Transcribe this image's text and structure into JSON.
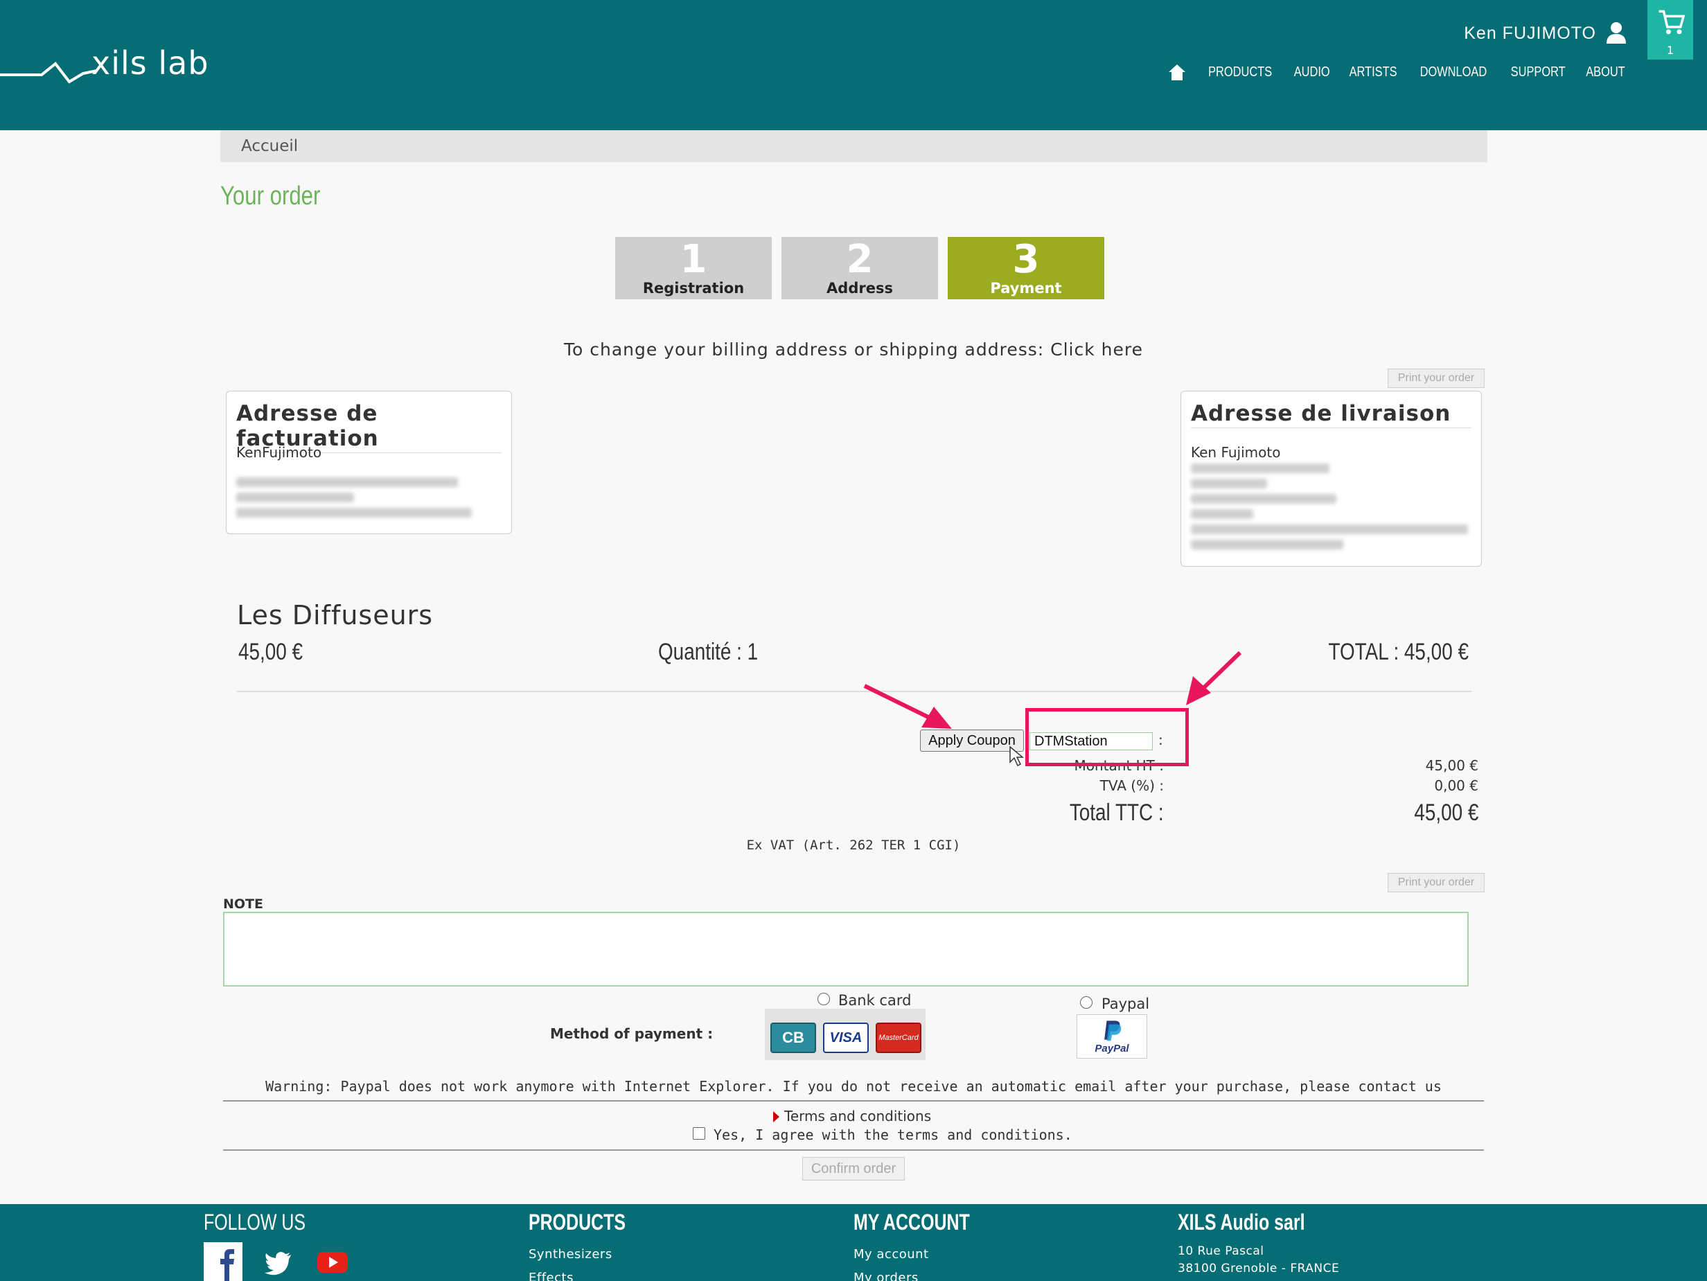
{
  "header": {
    "logo_text": "xils lab",
    "user_name": "Ken FUJIMOTO",
    "cart_count": "1",
    "nav": [
      "PRODUCTS",
      "AUDIO",
      "ARTISTS",
      "DOWNLOAD",
      "SUPPORT",
      "ABOUT"
    ]
  },
  "breadcrumb": "Accueil",
  "page_title": "Your order",
  "steps": [
    {
      "num": "1",
      "label": "Registration",
      "active": false
    },
    {
      "num": "2",
      "label": "Address",
      "active": false
    },
    {
      "num": "3",
      "label": "Payment",
      "active": true
    }
  ],
  "change_address_text": "To change your billing address or shipping address: Click here",
  "print_label": "Print your order",
  "billing": {
    "title": "Adresse de facturation",
    "name": "KenFujimoto"
  },
  "shipping": {
    "title": "Adresse de livraison",
    "name": "Ken Fujimoto"
  },
  "product": {
    "name": "Les Diffuseurs",
    "price": "45,00 €",
    "quantity": "Quantité : 1",
    "total": "TOTAL : 45,00 €"
  },
  "coupon": {
    "button": "Apply Coupon",
    "value": "DTMStation",
    "colon": ":"
  },
  "totals": {
    "montant_label": "Montant HT :",
    "montant_value": "45,00 €",
    "tva_label": "TVA (%) :",
    "tva_value": "0,00 €",
    "ttc_label": "Total TTC :",
    "ttc_value": "45,00 €"
  },
  "ex_vat": "Ex VAT (Art. 262 TER 1 CGI)",
  "note_label": "NOTE",
  "payment": {
    "label": "Method of payment :",
    "bank_card": "Bank card",
    "paypal": "Paypal",
    "card_visa": "VISA",
    "card_cb": "CB",
    "card_mc": "MasterCard",
    "paypal_logo": "PayPal"
  },
  "warning": "Warning: Paypal does not work anymore with Internet Explorer. If you do not receive an automatic email after your purchase, please contact us",
  "terms": "Terms and conditions",
  "agree": "Yes, I agree with the terms and conditions.",
  "confirm": "Confirm order",
  "footer": {
    "follow": "FOLLOW US",
    "products": "PRODUCTS",
    "products_links": [
      "Synthesizers",
      "Effects"
    ],
    "account": "MY ACCOUNT",
    "account_links": [
      "My account",
      "My orders"
    ],
    "company": "XILS Audio sarl",
    "address1": "10 Rue Pascal",
    "address2": "38100 Grenoble - FRANCE"
  },
  "colors": {
    "teal": "#076d74",
    "cart": "#1fb5a4",
    "active_step": "#9bac20",
    "title_green": "#6db35a",
    "highlight": "#e8175d"
  }
}
